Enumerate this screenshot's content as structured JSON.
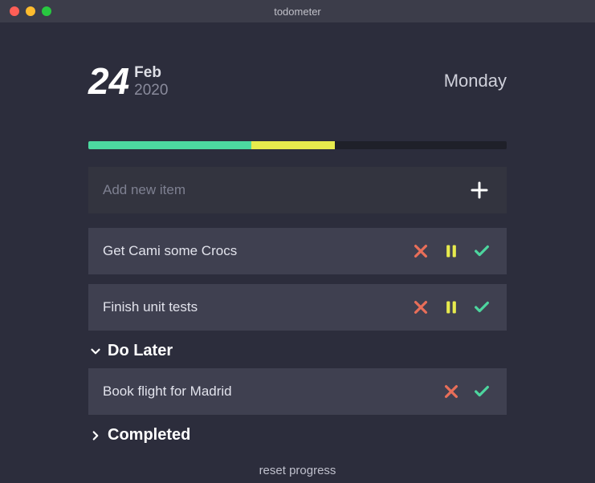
{
  "window": {
    "title": "todometer"
  },
  "date": {
    "day": "24",
    "month": "Feb",
    "year": "2020",
    "weekday": "Monday"
  },
  "progress": {
    "completed_pct": 39,
    "later_pct": 20
  },
  "add": {
    "placeholder": "Add new item"
  },
  "colors": {
    "green": "#4dd59e",
    "yellow": "#e7eb4d",
    "red": "#e86e59"
  },
  "todos": [
    {
      "text": "Get Cami some Crocs"
    },
    {
      "text": "Finish unit tests"
    }
  ],
  "sections": {
    "later": {
      "label": "Do Later",
      "expanded": true,
      "items": [
        {
          "text": "Book flight for Madrid"
        }
      ]
    },
    "completed": {
      "label": "Completed",
      "expanded": false
    }
  },
  "reset_label": "reset progress"
}
